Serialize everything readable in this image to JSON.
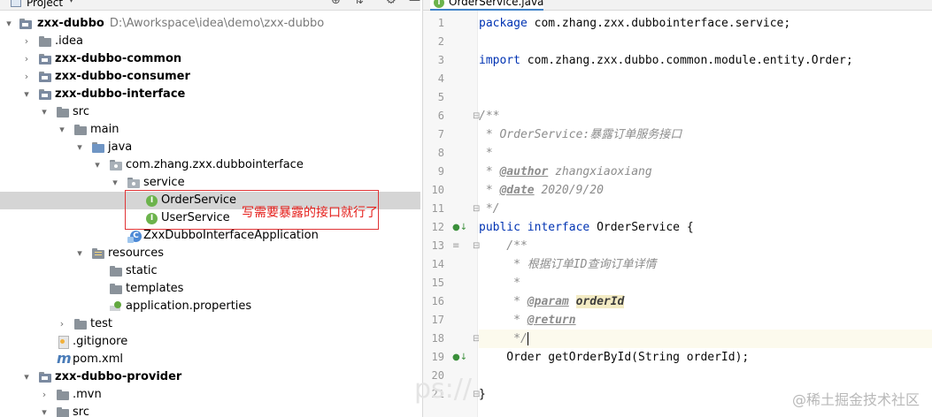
{
  "project_panel": {
    "title": "Project",
    "toolbar_icons": [
      "target-icon",
      "collapse-all-icon",
      "settings-icon",
      "minimize-icon"
    ],
    "tree": [
      {
        "id": "root",
        "label": "zxx-dubbo",
        "path": "D:\\Aworkspace\\idea\\demo\\zxx-dubbo",
        "icon": "module-folder-icon",
        "expanded": true
      },
      {
        "id": "idea",
        "label": ".idea",
        "icon": "folder-icon",
        "expanded": false
      },
      {
        "id": "common",
        "label": "zxx-dubbo-common",
        "icon": "module-folder-icon",
        "expanded": false
      },
      {
        "id": "consumer",
        "label": "zxx-dubbo-consumer",
        "icon": "module-folder-icon",
        "expanded": false
      },
      {
        "id": "interface",
        "label": "zxx-dubbo-interface",
        "icon": "module-folder-icon",
        "expanded": true
      },
      {
        "id": "src",
        "label": "src",
        "icon": "folder-icon",
        "expanded": true
      },
      {
        "id": "main",
        "label": "main",
        "icon": "folder-icon",
        "expanded": true
      },
      {
        "id": "java",
        "label": "java",
        "icon": "source-folder-icon",
        "expanded": true
      },
      {
        "id": "pkg",
        "label": "com.zhang.zxx.dubbointerface",
        "icon": "package-icon",
        "expanded": true
      },
      {
        "id": "service",
        "label": "service",
        "icon": "package-icon",
        "expanded": true
      },
      {
        "id": "orderservice",
        "label": "OrderService",
        "icon": "interface-icon",
        "selected": true
      },
      {
        "id": "userservice",
        "label": "UserService",
        "icon": "interface-icon"
      },
      {
        "id": "app",
        "label": "ZxxDubboInterfaceApplication",
        "icon": "spring-class-icon"
      },
      {
        "id": "resources",
        "label": "resources",
        "icon": "resources-folder-icon",
        "expanded": true
      },
      {
        "id": "static",
        "label": "static",
        "icon": "folder-icon"
      },
      {
        "id": "templates",
        "label": "templates",
        "icon": "folder-icon"
      },
      {
        "id": "props",
        "label": "application.properties",
        "icon": "properties-file-icon"
      },
      {
        "id": "test",
        "label": "test",
        "icon": "folder-icon",
        "expanded": false
      },
      {
        "id": "gitignore",
        "label": ".gitignore",
        "icon": "gitignore-file-icon"
      },
      {
        "id": "pom",
        "label": "pom.xml",
        "icon": "maven-icon"
      },
      {
        "id": "provider",
        "label": "zxx-dubbo-provider",
        "icon": "module-folder-icon",
        "expanded": true
      },
      {
        "id": "mvn",
        "label": ".mvn",
        "icon": "folder-icon",
        "expanded": false
      },
      {
        "id": "src2",
        "label": "src",
        "icon": "folder-icon",
        "expanded": true
      }
    ],
    "annotation": "写需要暴露的接口就行了"
  },
  "editor": {
    "tab": {
      "label": "OrderService.java",
      "icon": "interface-icon"
    },
    "current_line": 18,
    "lines": [
      {
        "n": "1"
      },
      {
        "n": "2"
      },
      {
        "n": "3"
      },
      {
        "n": "4"
      },
      {
        "n": "5"
      },
      {
        "n": "6"
      },
      {
        "n": "7"
      },
      {
        "n": "8"
      },
      {
        "n": "9"
      },
      {
        "n": "10"
      },
      {
        "n": "11"
      },
      {
        "n": "12"
      },
      {
        "n": "13"
      },
      {
        "n": "14"
      },
      {
        "n": "15"
      },
      {
        "n": "16"
      },
      {
        "n": "17"
      },
      {
        "n": "18"
      },
      {
        "n": "19"
      },
      {
        "n": "20"
      },
      {
        "n": "21"
      }
    ],
    "code": {
      "l1_kw": "package",
      "l1_rest": " com.zhang.zxx.dubbointerface.service;",
      "l3_kw": "import",
      "l3_rest": " com.zhang.zxx.dubbo.common.module.entity.Order;",
      "l6": "/**",
      "l7": " * OrderService:暴露订单服务接口",
      "l8": " *",
      "l9_pre": " * ",
      "l9_tag": "@author",
      "l9_rest": " zhangxiaoxiang",
      "l10_pre": " * ",
      "l10_tag": "@date",
      "l10_rest": " 2020/9/20",
      "l11": " */",
      "l12_kw1": "public",
      "l12_kw2": "interface",
      "l12_rest": " OrderService {",
      "l13": "    /**",
      "l14": "     * 根据订单ID查询订单详情",
      "l15": "     *",
      "l16_pre": "     * ",
      "l16_tag": "@param",
      "l16_param": "orderId",
      "l17_pre": "     * ",
      "l17_tag": "@return",
      "l18": "     */",
      "l19": "    Order getOrderById(String orderId);",
      "l21": "}"
    },
    "gutter_icons": {
      "line12": "implemented-icon",
      "line19": "implemented-icon",
      "line18": "lightbulb-icon"
    }
  },
  "watermark": {
    "right": "@稀土掘金技术社区",
    "left": "ps://"
  },
  "colors": {
    "selection": "#d5d5d5",
    "annotation_red": "#e03436",
    "keyword": "#0033b3",
    "comment": "#8c8c8c",
    "tab_underline": "#4083c9"
  }
}
